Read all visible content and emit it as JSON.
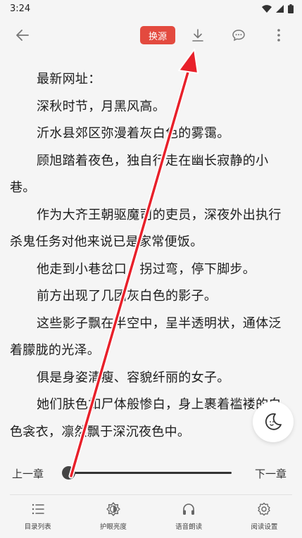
{
  "status_bar": {
    "time": "3:24"
  },
  "toolbar": {
    "back_icon": "arrow-left-icon",
    "source_label": "换源",
    "download_icon": "download-icon",
    "comment_icon": "comment-icon",
    "more_icon": "more-vertical-icon",
    "accent_color": "#e34a3f"
  },
  "content": {
    "paragraphs": [
      "最新网址：",
      "深秋时节，月黑风高。",
      "沂水县郊区弥漫着灰白色的雾霭。",
      "顾旭踏着夜色，独自行走在幽长寂静的小巷。",
      "作为大齐王朝驱魔司的吏员，深夜外出执行杀鬼任务对他来说已是家常便饭。",
      "他走到小巷岔口，拐过弯，停下脚步。",
      "前方出现了几团灰白色的影子。",
      "这些影子飘在半空中，呈半透明状，通体泛着朦胧的光泽。",
      "俱是身姿清瘦、容貌纤丽的女子。",
      "她们肤色如尸体般惨白，身上裹着褴褛的白色衾衣，凛然飘于深沉夜色中。"
    ]
  },
  "night_mode": {
    "icon": "moon-icon"
  },
  "progress": {
    "prev_label": "上一章",
    "next_label": "下一章",
    "value": 0.0
  },
  "bottom_nav": {
    "items": [
      {
        "label": "目录列表",
        "icon": "list-icon"
      },
      {
        "label": "护眼亮度",
        "icon": "brightness-icon"
      },
      {
        "label": "语音朗读",
        "icon": "headphones-icon"
      },
      {
        "label": "阅读设置",
        "icon": "settings-gear-icon"
      }
    ]
  },
  "annotation": {
    "arrow_color": "#e8202a"
  }
}
